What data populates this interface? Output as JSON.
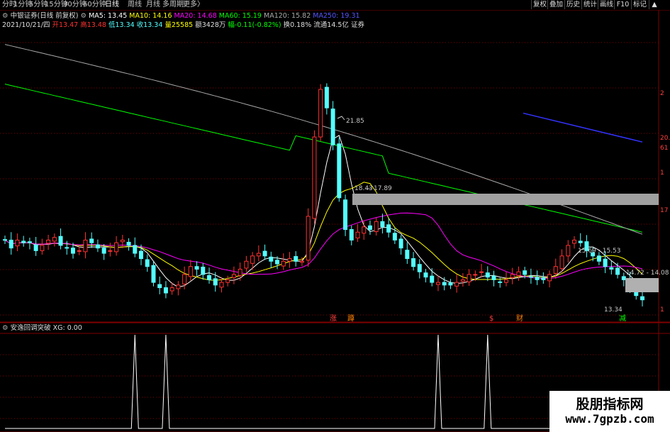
{
  "toolbar": {
    "periods": [
      "分时",
      "1分钟",
      "5分钟",
      "15分钟",
      "30分钟",
      "60分钟",
      "日线",
      "周线",
      "月线",
      "多周期",
      "更多"
    ],
    "active_period": "日线",
    "buttons": [
      "复权",
      "叠加",
      "历史",
      "统计",
      "画线",
      "F10",
      "标记"
    ]
  },
  "header": {
    "stock": "中银证券(日线 前复权)",
    "ma5_label": "MA5: 13.45",
    "ma10_label": "MA10: 14.16",
    "ma20_label": "MA20: 14.68",
    "ma60_label": "MA60: 15.19",
    "ma120_label": "MA120: 15.82",
    "ma250_label": "MA250: 19.31",
    "date": "2021/10/21/四",
    "open": "开13.47",
    "high": "高13.48",
    "low": "低13.34",
    "close": "收13.34",
    "volume": "量25585",
    "amount": "额3428万",
    "change": "幅-0.11(-0.82%)",
    "turnover": "换0.18%",
    "float": "流通14.5亿",
    "sector": "证券"
  },
  "price_labels": {
    "high": "21.85",
    "local_high_a": "18.43",
    "local_high_b": "17.89",
    "range_c": "15.69 - 15.53",
    "range_d": "14.72 - 14.08",
    "low": "13.34"
  },
  "signal_labels": [
    "涨",
    "蹲",
    "$",
    "财",
    "减"
  ],
  "indicator": {
    "name": "安逸回调突破",
    "value_label": "XG: 0.00"
  },
  "axis_labels": [
    "2",
    "20.6",
    "61",
    "1",
    "17",
    "1"
  ],
  "colors": {
    "up": "#ff3232",
    "down": "#54ffff",
    "ma5": "#ffffff",
    "ma10": "#ffff00",
    "ma20": "#ff00ff",
    "ma60": "#00ff00",
    "ma120": "#aaaaaa",
    "ma250": "#3333ff",
    "grid": "#800000"
  },
  "watermark": {
    "line1": "股朋指标网",
    "line2": "www.7gpzb.com"
  },
  "chart_data": {
    "type": "candlestick",
    "price_ylim": [
      12.5,
      23.5
    ],
    "signal_ylim": [
      0,
      1
    ],
    "closes": [
      15.6,
      15.3,
      15.6,
      15.5,
      15.5,
      15.2,
      15.4,
      15.6,
      15.7,
      15.4,
      15.3,
      15.1,
      15.2,
      15.6,
      15.5,
      15.3,
      15.1,
      15.2,
      15.5,
      15.6,
      15.4,
      15.1,
      14.9,
      14.6,
      14.0,
      13.8,
      13.6,
      13.8,
      13.9,
      14.3,
      14.6,
      14.5,
      14.3,
      14.1,
      13.9,
      14.0,
      14.1,
      14.3,
      14.5,
      14.8,
      15.0,
      15.1,
      15.0,
      14.8,
      14.7,
      14.8,
      14.9,
      14.8,
      14.8,
      16.5,
      19.5,
      21.3,
      20.6,
      19.2,
      17.2,
      16.0,
      15.6,
      15.9,
      16.1,
      16.0,
      16.3,
      16.1,
      15.9,
      15.6,
      15.3,
      14.9,
      14.6,
      14.4,
      14.2,
      14.0,
      14.0,
      13.9,
      13.9,
      14.0,
      14.1,
      14.3,
      14.3,
      14.4,
      14.2,
      14.1,
      14.0,
      14.1,
      14.3,
      14.4,
      14.3,
      14.2,
      14.1,
      14.1,
      14.3,
      14.6,
      15.0,
      15.4,
      15.6,
      15.5,
      15.2,
      15.0,
      14.8,
      14.6,
      14.5,
      14.3,
      14.1,
      13.8,
      13.5,
      13.34
    ],
    "signal_days": [
      21,
      26,
      70,
      78
    ],
    "ma_names": [
      "MA5",
      "MA10",
      "MA20",
      "MA60",
      "MA120",
      "MA250"
    ]
  }
}
